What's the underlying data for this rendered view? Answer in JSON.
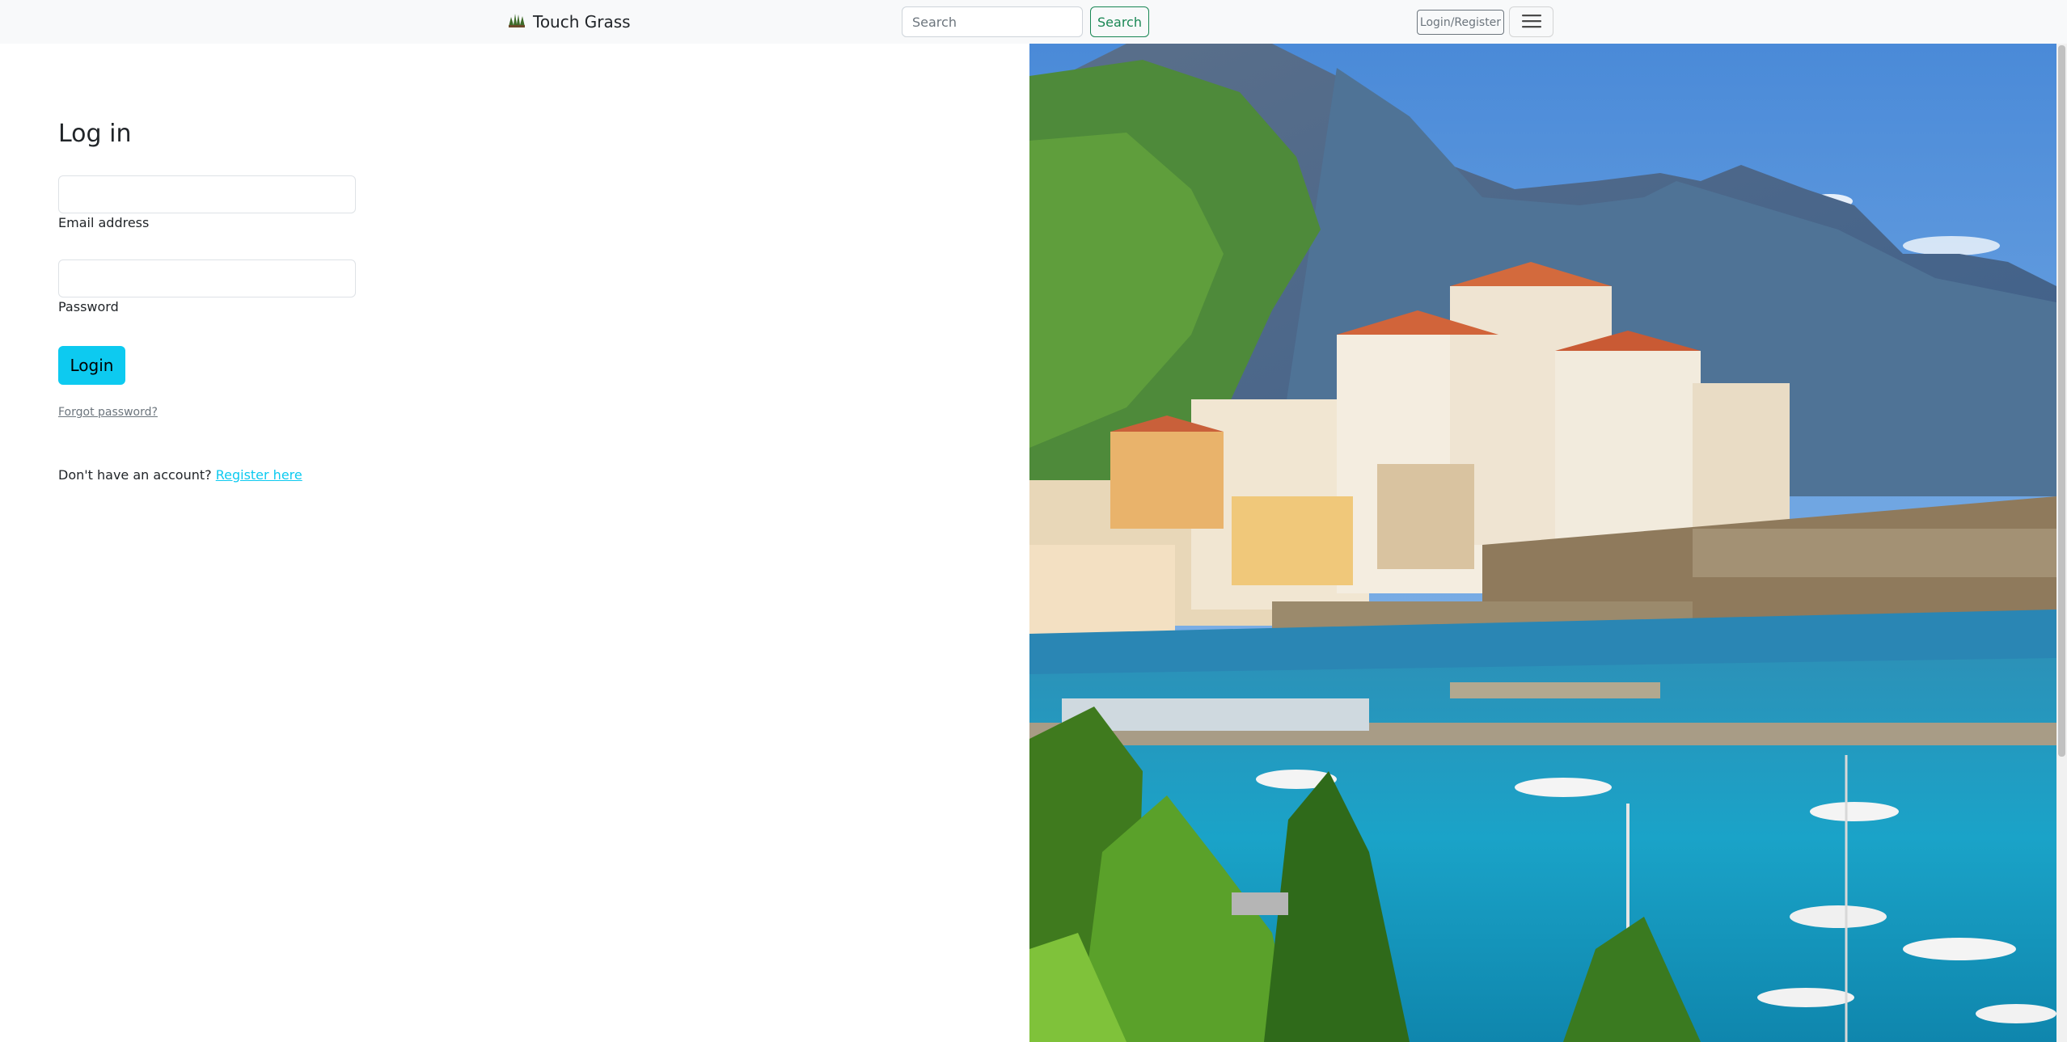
{
  "navbar": {
    "brand_icon": "grass-icon",
    "brand_text": "Touch Grass",
    "search_placeholder": "Search",
    "search_button": "Search",
    "login_register_button": "Login/Register",
    "menu_icon": "hamburger-menu-icon"
  },
  "form": {
    "heading": "Log in",
    "email_label": "Email address",
    "password_label": "Password",
    "login_button": "Login",
    "forgot_link": "Forgot password?",
    "register_prompt": "Don't have an account?",
    "register_link": "Register here"
  },
  "colors": {
    "accent": "#0dcaf0",
    "success": "#198754",
    "navbar_bg": "#f8f9fa"
  },
  "hero_image": {
    "icon": "coastal-town-photo"
  }
}
